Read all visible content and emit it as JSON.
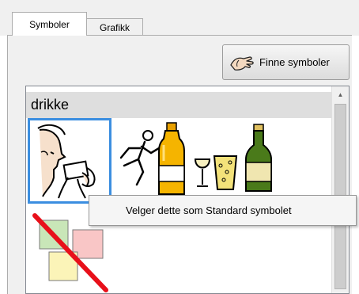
{
  "tabs": [
    {
      "label": "Symboler",
      "active": true
    },
    {
      "label": "Grafikk",
      "active": false
    }
  ],
  "find_button": {
    "label": "Finne symboler",
    "icon": "hand-icon"
  },
  "category": {
    "title": "drikke"
  },
  "symbols": [
    {
      "name": "person-drinking",
      "selected": true
    },
    {
      "name": "runner-with-bottle"
    },
    {
      "name": "wine-glass-and-beer-glass"
    },
    {
      "name": "green-bottle"
    },
    {
      "name": "no-symbol"
    }
  ],
  "context_menu": {
    "items": [
      {
        "label": "Velger dette som Standard symbolet"
      }
    ]
  },
  "colors": {
    "selection": "#3b8ee0",
    "no_symbol_line": "#e8101a"
  }
}
